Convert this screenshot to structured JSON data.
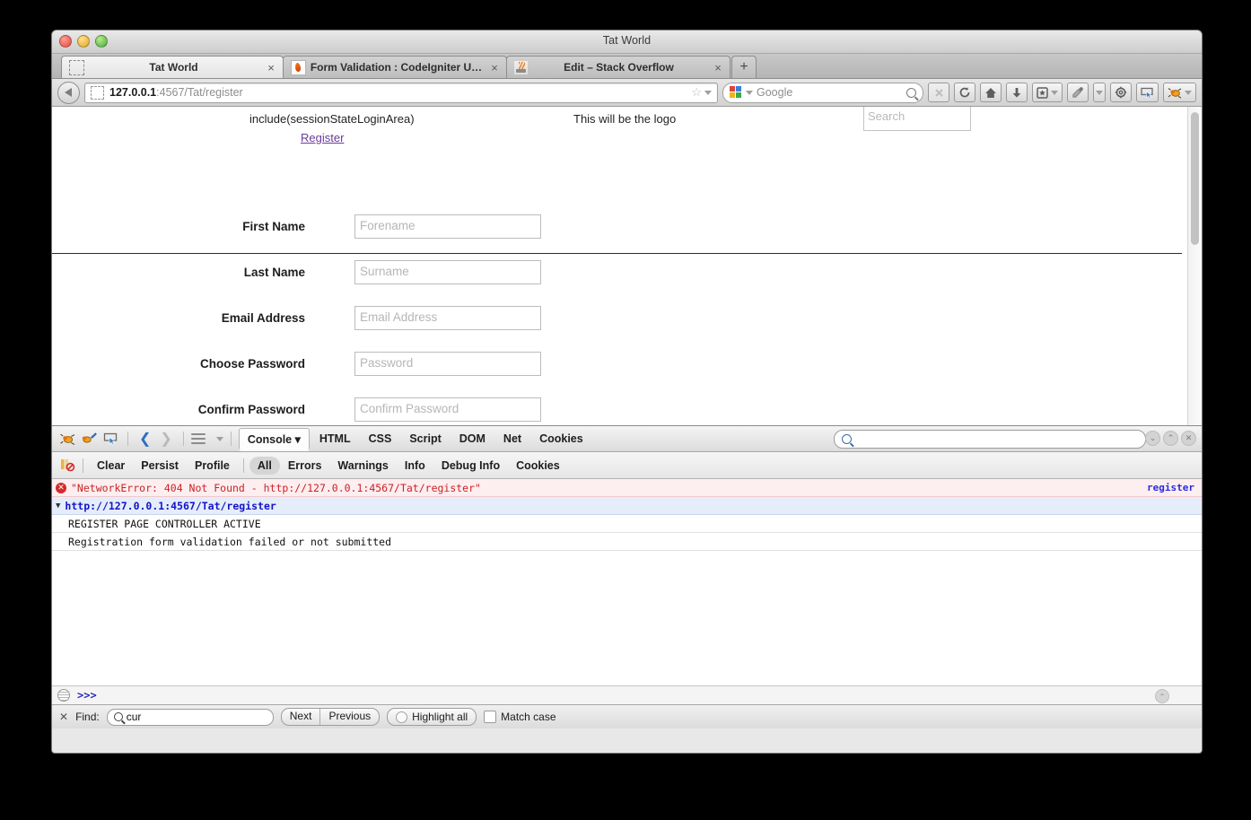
{
  "window": {
    "title": "Tat World"
  },
  "tabs": [
    {
      "label": "Tat World",
      "favicon": "blank-dashed-icon",
      "active": true,
      "close": "×"
    },
    {
      "label": "Form Validation : CodeIgniter U…",
      "favicon": "codeigniter-flame-icon",
      "active": false,
      "close": "×"
    },
    {
      "label": "Edit – Stack Overflow",
      "favicon": "stackoverflow-icon",
      "active": false,
      "close": "×"
    }
  ],
  "new_tab_label": "+",
  "navbar": {
    "back_icon": "back-arrow-icon",
    "url_favicon": "blank-dashed-icon",
    "url_host": "127.0.0.1",
    "url_path": ":4567/Tat/register",
    "bookmark_star": "☆",
    "url_dropdown": "chevron-down-icon",
    "search_engine": "google-logo-icon",
    "search_value": "Google",
    "search_icon": "magnifier-icon",
    "buttons": [
      {
        "name": "stop-button",
        "icon": "✕",
        "disabled": true
      },
      {
        "name": "reload-button",
        "icon": "↻",
        "disabled": false
      },
      {
        "name": "home-button",
        "icon": "home-icon",
        "disabled": false
      },
      {
        "name": "downloads-button",
        "icon": "download-arrow-icon",
        "disabled": false
      },
      {
        "name": "bookmarks-button",
        "icon": "bookmark-star-box-icon",
        "disabled": false
      },
      {
        "name": "eyedropper-button",
        "icon": "eyedropper-icon",
        "disabled": false
      },
      {
        "name": "settings-button",
        "icon": "gear-icon",
        "disabled": false
      },
      {
        "name": "inspect-button",
        "icon": "select-element-icon",
        "disabled": false
      },
      {
        "name": "firebug-button",
        "icon": "firebug-bug-icon",
        "disabled": false
      }
    ]
  },
  "page": {
    "include_text": "include(sessionStateLoginArea)",
    "register_link": "Register",
    "logo_text": "This will be the logo",
    "search_placeholder": "Search",
    "form_rows": [
      {
        "label": "First Name",
        "placeholder": "Forename"
      },
      {
        "label": "Last Name",
        "placeholder": "Surname"
      },
      {
        "label": "Email Address",
        "placeholder": "Email Address"
      },
      {
        "label": "Choose Password",
        "placeholder": "Password"
      },
      {
        "label": "Confirm Password",
        "placeholder": "Confirm Password"
      }
    ]
  },
  "firebug": {
    "toolbar_icons": [
      "firebug-bug-icon",
      "firebug-inspect-icon",
      "select-element-icon"
    ],
    "nav_back": "❮",
    "nav_forward": "❯",
    "panel_menu_icon": "hamburger-icon",
    "panel_dropdown_icon": "chevron-down-icon",
    "panels": [
      {
        "label": "Console",
        "selected": true,
        "caret": "▾"
      },
      {
        "label": "HTML",
        "selected": false
      },
      {
        "label": "CSS",
        "selected": false
      },
      {
        "label": "Script",
        "selected": false
      },
      {
        "label": "DOM",
        "selected": false
      },
      {
        "label": "Net",
        "selected": false
      },
      {
        "label": "Cookies",
        "selected": false
      }
    ],
    "search_placeholder": "",
    "search_icon": "magnifier-icon",
    "right_buttons": [
      "chevron-down-circle-icon",
      "chevron-up-circle-icon",
      "close-circle-icon"
    ],
    "options": [
      {
        "label": "Clear",
        "selected": false
      },
      {
        "label": "Persist",
        "selected": false
      },
      {
        "label": "Profile",
        "selected": false
      }
    ],
    "filters": [
      {
        "label": "All",
        "selected": true
      },
      {
        "label": "Errors",
        "selected": false
      },
      {
        "label": "Warnings",
        "selected": false
      },
      {
        "label": "Info",
        "selected": false
      },
      {
        "label": "Debug Info",
        "selected": false
      },
      {
        "label": "Cookies",
        "selected": false
      }
    ],
    "console_rows": [
      {
        "type": "error",
        "icon": "error-circle-icon",
        "text": "\"NetworkError: 404 Not Found - http://127.0.0.1:4567/Tat/register\"",
        "source_link": "register"
      },
      {
        "type": "group",
        "twisty": "▼",
        "text": "http://127.0.0.1:4567/Tat/register"
      },
      {
        "type": "log",
        "text": "REGISTER PAGE CONTROLLER ACTIVE"
      },
      {
        "type": "log",
        "text": "Registration form validation failed or not submitted"
      }
    ],
    "command_prompt": ">>>",
    "command_icon": "console-lines-icon",
    "command_up_icon": "chevron-up-circle-icon"
  },
  "findbar": {
    "close_icon": "✕",
    "label": "Find:",
    "search_icon": "magnifier-icon",
    "value": "cur",
    "next_label": "Next",
    "previous_label": "Previous",
    "highlight_label": "Highlight all",
    "match_case_label": "Match case"
  },
  "colors": {
    "error_text": "#cc2222",
    "error_bg": "#fdeef0",
    "group_text": "#1414c8",
    "group_bg": "#e5edfb",
    "visited_link": "#6a3a9c",
    "source_link": "#2b2bdd"
  }
}
